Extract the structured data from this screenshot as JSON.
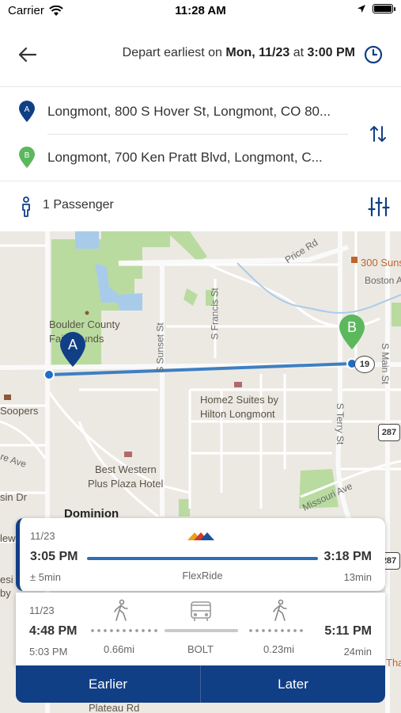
{
  "status_bar": {
    "carrier": "Carrier",
    "time": "11:28 AM",
    "wifi_icon": "wifi-icon",
    "location_icon": "location-arrow-icon",
    "battery_icon": "battery-icon"
  },
  "header": {
    "back_icon": "arrow-left-icon",
    "depart_prefix": "Depart earliest on ",
    "depart_datetime": "Mon, 11/23",
    "depart_at": " at ",
    "depart_time": "3:00 PM",
    "clock_icon": "clock-icon"
  },
  "locations": {
    "origin": {
      "badge": "A",
      "text": "Longmont, 800 S Hover St, Longmont, CO 80...",
      "color": "#113f86"
    },
    "destination": {
      "badge": "B",
      "text": "Longmont, 700 Ken Pratt Blvd, Longmont, C...",
      "color": "#5cb85c"
    },
    "swap_icon": "swap-vertical-icon"
  },
  "passengers": {
    "label": "1 Passenger",
    "person_icon": "person-icon",
    "filter_icon": "sliders-icon"
  },
  "map": {
    "labels": {
      "price_rd": "Price Rd",
      "suns": "300 Suns",
      "boston": "Boston A",
      "fairgrounds_1": "Boulder County",
      "fairgrounds_2": "Fairgrounds",
      "s_sunset": "S Sunset St",
      "s_francis": "S Francis St",
      "s_main": "S Main St",
      "s_terry": "S Terry St",
      "home2_1": "Home2 Suites by",
      "home2_2": "Hilton Longmont",
      "soopers": "Soopers",
      "best_western_1": "Best Western",
      "best_western_2": "Plus Plaza Hotel",
      "re_ave": "re Ave",
      "sin_dr": "sin Dr",
      "missouri": "Missouri Ave",
      "dominion": "Dominion",
      "new": "lew",
      "resi": "esi",
      "by": "by",
      "tha": "Tha",
      "plateau": "Plateau Rd",
      "shield_19": "19",
      "shield_287": "287",
      "marker_a": "A",
      "marker_b": "B"
    }
  },
  "trips": [
    {
      "date": "11/23",
      "depart": "3:05 PM",
      "arrive": "3:18 PM",
      "variance": "± 5min",
      "mode": "FlexRide",
      "duration": "13min",
      "logo_icon": "flexride-logo-icon"
    },
    {
      "date": "11/23",
      "depart": "4:48 PM",
      "arrive": "5:11 PM",
      "sub_depart": "5:03 PM",
      "duration": "24min",
      "legs": [
        {
          "icon": "walk-icon",
          "label": "0.66mi"
        },
        {
          "icon": "bus-icon",
          "label": "BOLT"
        },
        {
          "icon": "walk-icon",
          "label": "0.23mi"
        }
      ]
    }
  ],
  "buttons": {
    "earlier": "Earlier",
    "later": "Later"
  }
}
